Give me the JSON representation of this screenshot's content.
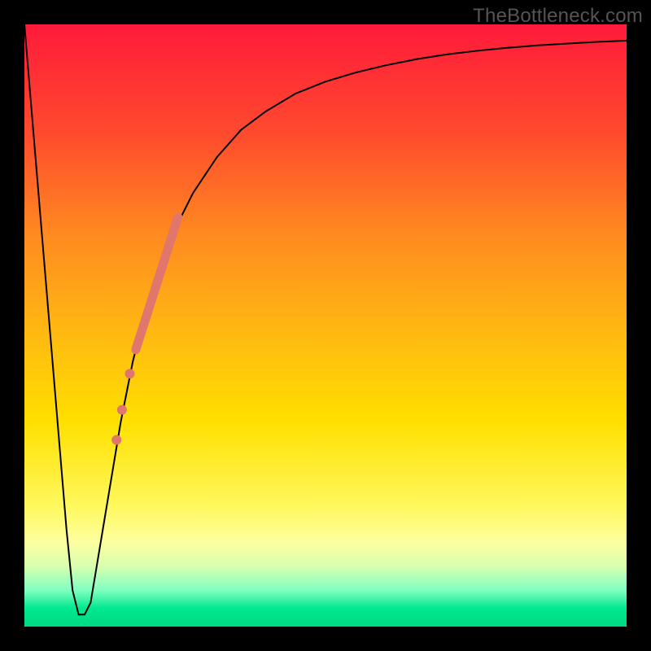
{
  "watermark": {
    "text": "TheBottleneck.com"
  },
  "chart_data": {
    "type": "line",
    "title": "",
    "xlabel": "",
    "ylabel": "",
    "xlim": [
      0,
      100
    ],
    "ylim": [
      0,
      100
    ],
    "grid": false,
    "legend": false,
    "background_gradient": {
      "stops": [
        {
          "pos": 0.0,
          "color": "#ff1a3a"
        },
        {
          "pos": 0.18,
          "color": "#ff4a2e"
        },
        {
          "pos": 0.35,
          "color": "#ff8a20"
        },
        {
          "pos": 0.48,
          "color": "#ffb015"
        },
        {
          "pos": 0.66,
          "color": "#ffe000"
        },
        {
          "pos": 0.8,
          "color": "#fff85e"
        },
        {
          "pos": 0.86,
          "color": "#fdffa0"
        },
        {
          "pos": 0.9,
          "color": "#d8ffb0"
        },
        {
          "pos": 0.94,
          "color": "#7fffc0"
        },
        {
          "pos": 0.97,
          "color": "#00e890"
        },
        {
          "pos": 1.0,
          "color": "#00d982"
        }
      ]
    },
    "series": [
      {
        "name": "bottleneck-curve",
        "color": "#000000",
        "stroke_width": 2,
        "x": [
          0,
          1,
          2,
          3,
          4,
          5,
          6,
          7,
          8,
          9,
          10,
          11,
          12,
          14,
          16,
          18,
          20,
          22,
          25,
          28,
          32,
          36,
          40,
          45,
          50,
          55,
          60,
          65,
          70,
          75,
          80,
          85,
          90,
          95,
          100
        ],
        "y": [
          100,
          88,
          76,
          64,
          52,
          40,
          28,
          16,
          6,
          2,
          2,
          4,
          10,
          22,
          34,
          44,
          52,
          58,
          66,
          72,
          78,
          82.5,
          85.5,
          88.5,
          90.5,
          92,
          93.2,
          94.2,
          95,
          95.6,
          96.1,
          96.5,
          96.8,
          97.1,
          97.3
        ]
      },
      {
        "name": "highlight-band",
        "color": "#e0766c",
        "stroke_width": 11,
        "x": [
          18.5,
          25.5
        ],
        "y": [
          46,
          68
        ]
      },
      {
        "name": "highlight-dot-1",
        "type_override": "scatter",
        "color": "#e0766c",
        "radius": 6,
        "x": [
          17.5
        ],
        "y": [
          42
        ]
      },
      {
        "name": "highlight-dot-2",
        "type_override": "scatter",
        "color": "#e0766c",
        "radius": 6,
        "x": [
          16.2
        ],
        "y": [
          36
        ]
      },
      {
        "name": "highlight-dot-3",
        "type_override": "scatter",
        "color": "#e0766c",
        "radius": 6,
        "x": [
          15.3
        ],
        "y": [
          31
        ]
      }
    ]
  }
}
